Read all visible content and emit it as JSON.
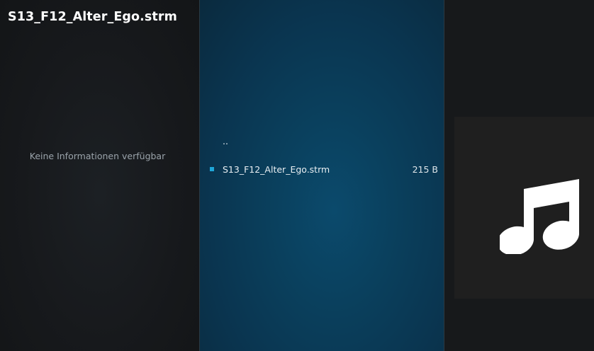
{
  "header": {
    "title": "S13_F12_Alter_Ego.strm"
  },
  "info_panel": {
    "empty_message": "Keine Informationen verfügbar"
  },
  "file_list": {
    "items": [
      {
        "name": "..",
        "size": "",
        "has_bullet": false
      },
      {
        "name": "S13_F12_Alter_Ego.strm",
        "size": "215 B",
        "has_bullet": true
      }
    ]
  },
  "preview": {
    "icon": "music-note-icon"
  },
  "colors": {
    "accent": "#1fa6d8",
    "list_background": "#0a3f5c",
    "side_background": "#17191c"
  }
}
